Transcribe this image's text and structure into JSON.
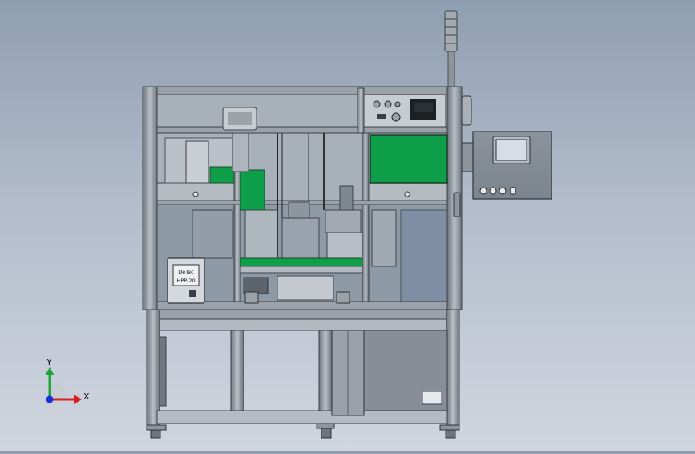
{
  "model": {
    "controller_label_line1": "DeTec",
    "controller_label_line2": "HPP-20"
  },
  "triad": {
    "y_label": "Y",
    "x_label": "X"
  },
  "colors": {
    "background_top": "#8f9eb0",
    "background_bottom": "#d0d6df",
    "frame": "#9ba2ab",
    "green_panel": "#0f9f4a",
    "lcd": "#d7dde6",
    "axis_x": "#d62020",
    "axis_y": "#22a33a",
    "axis_z": "#1a2fd8"
  },
  "icons": [
    "signal-tower-icon",
    "axis-triad-icon"
  ]
}
